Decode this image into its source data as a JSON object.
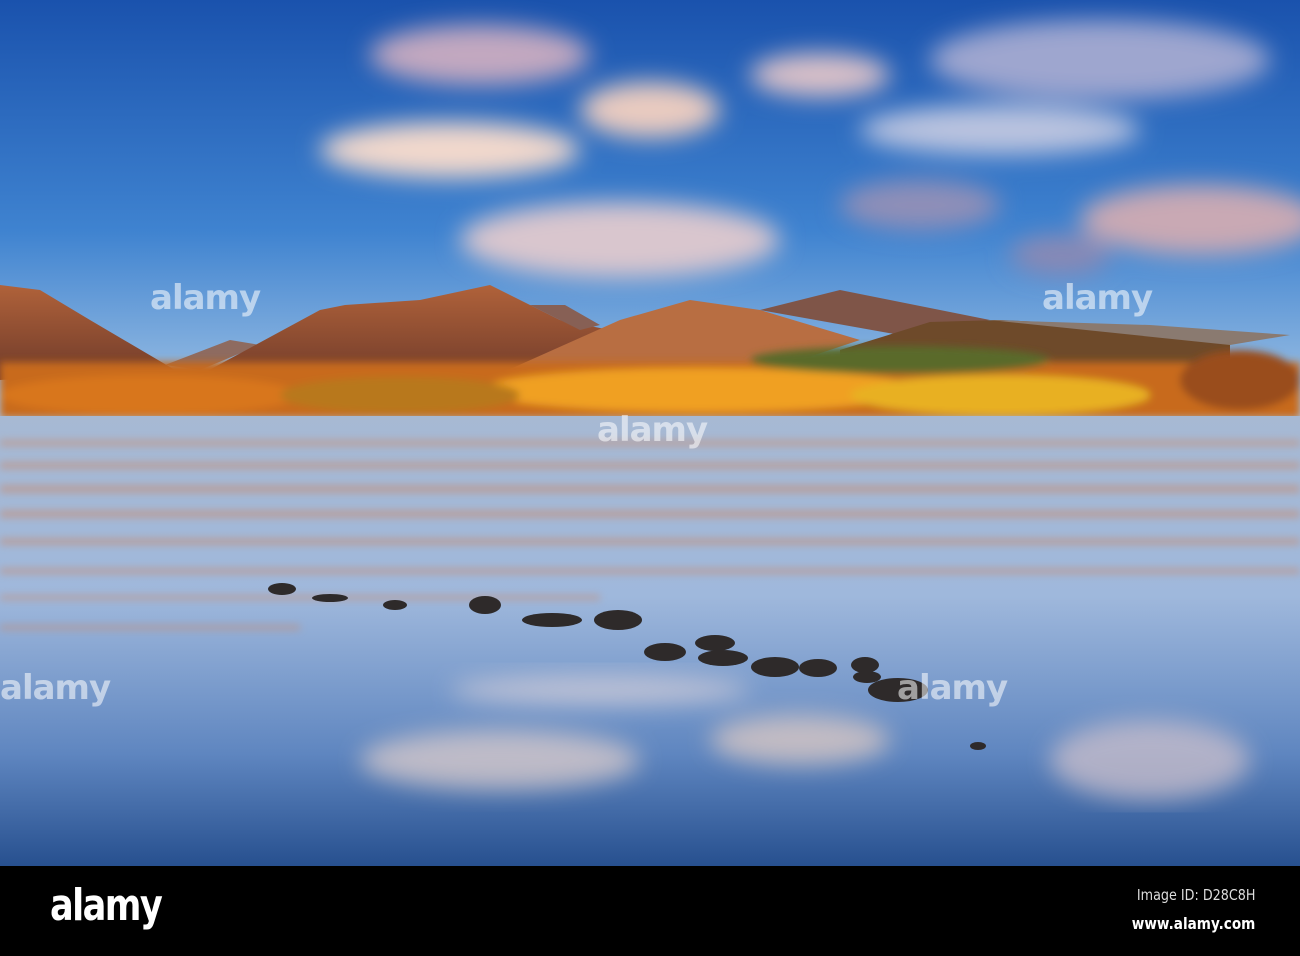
{
  "photo": {
    "watermark": "alamy",
    "colors": {
      "sky_top": "#1d56b0",
      "sky_horizon": "#9cc0e4",
      "mountain": "#8e4a2c",
      "trees": "#e08a1c",
      "water": "#7f9cc8"
    }
  },
  "footer": {
    "logo": "alamy",
    "image_id": "Image ID: D28C8H",
    "url": "www.alamy.com"
  }
}
